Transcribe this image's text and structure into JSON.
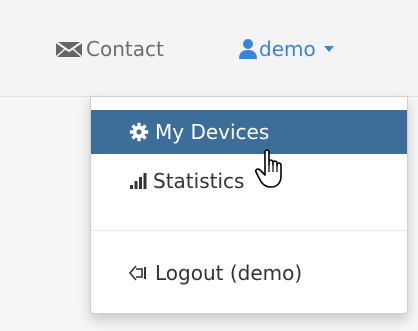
{
  "navbar": {
    "contact": {
      "label": "Contact",
      "icon": "envelope-icon"
    },
    "user": {
      "label": "demo",
      "icon": "user-icon",
      "accent": "#3a86d6"
    }
  },
  "dropdown": {
    "items": [
      {
        "label": "My Devices",
        "icon": "gear-icon",
        "active": true
      },
      {
        "label": "Statistics",
        "icon": "signal-bars-icon"
      },
      {
        "label": "Logout (demo)",
        "icon": "logout-icon"
      }
    ],
    "active_color": "#3c6e99"
  }
}
